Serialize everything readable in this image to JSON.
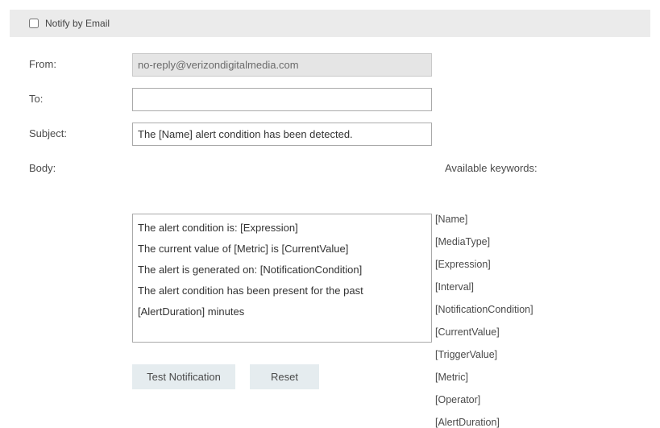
{
  "header": {
    "checkbox_label": "Notify by Email",
    "checked": false
  },
  "form": {
    "from": {
      "label": "From:",
      "value": "no-reply@verizondigitalmedia.com",
      "readonly": true
    },
    "to": {
      "label": "To:",
      "value": ""
    },
    "subject": {
      "label": "Subject:",
      "value": "The [Name] alert condition has been detected."
    },
    "body": {
      "label": "Body:",
      "value": "The alert condition is: [Expression]\nThe current value of [Metric] is [CurrentValue]\nThe alert is generated on: [NotificationCondition]\nThe alert condition has been present for the past [AlertDuration] minutes"
    }
  },
  "keywords": {
    "title": "Available keywords:",
    "items": [
      "[Name]",
      "[MediaType]",
      "[Expression]",
      "[Interval]",
      "[NotificationCondition]",
      "[CurrentValue]",
      "[TriggerValue]",
      "[Metric]",
      "[Operator]",
      "[AlertDuration]"
    ]
  },
  "buttons": {
    "test": "Test Notification",
    "reset": "Reset"
  }
}
